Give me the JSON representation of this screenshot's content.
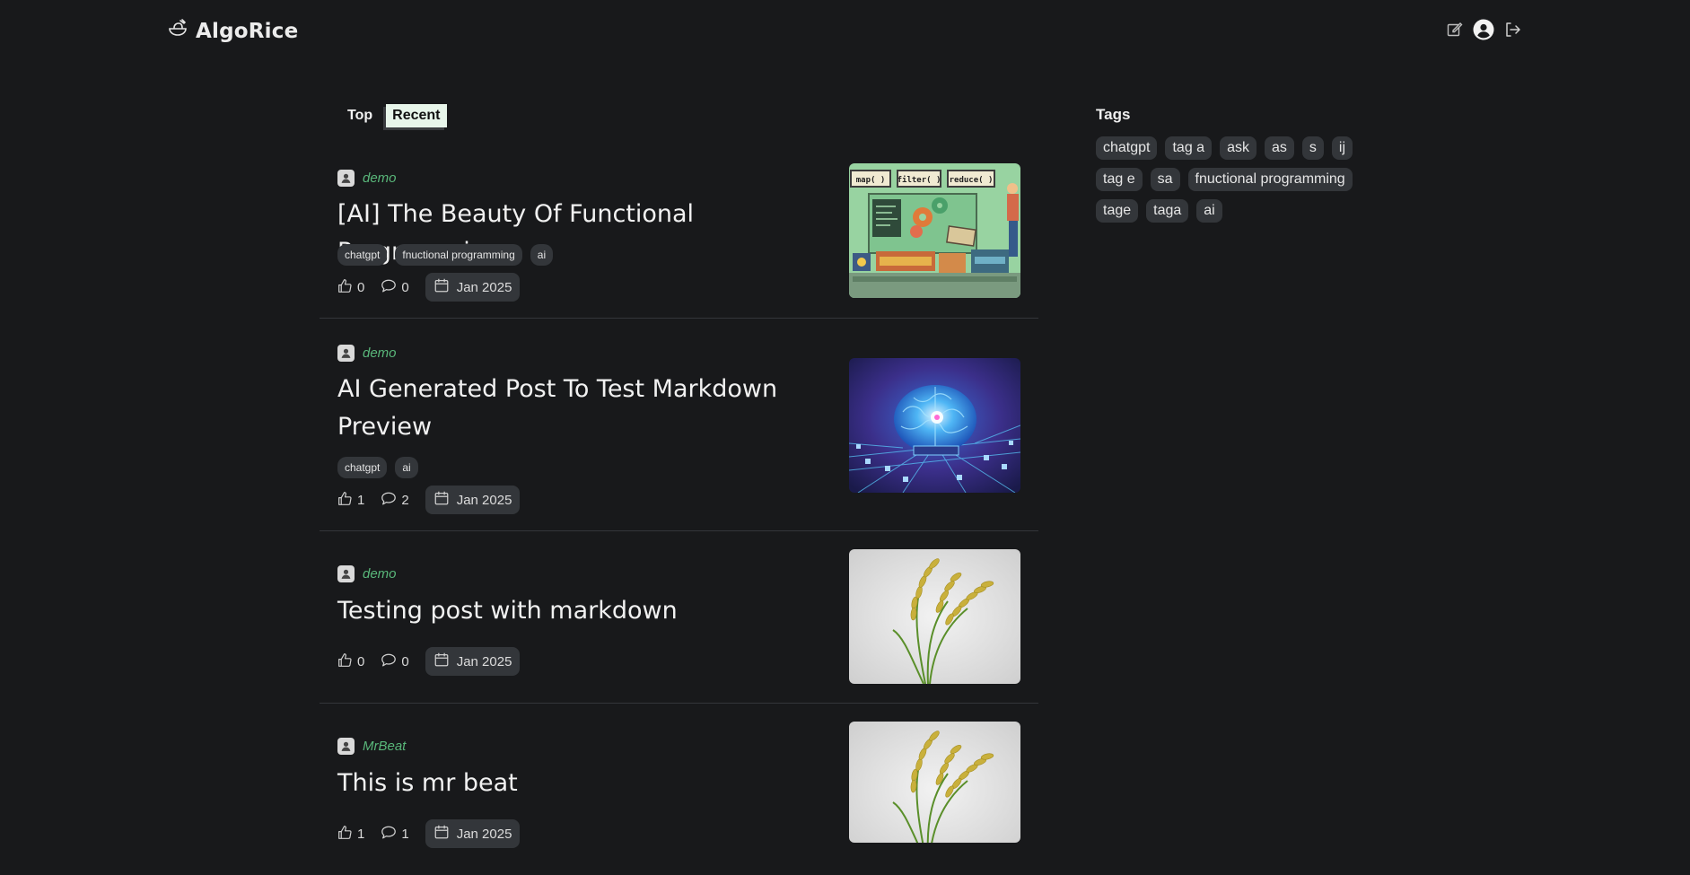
{
  "brand": {
    "name": "AlgoRice",
    "icon": "rice-bowl-icon"
  },
  "header": {
    "actions": [
      {
        "icon": "edit-icon"
      },
      {
        "icon": "user-avatar-icon"
      },
      {
        "icon": "logout-icon"
      }
    ]
  },
  "tabs": [
    {
      "label": "Top",
      "active": false
    },
    {
      "label": "Recent",
      "active": true
    }
  ],
  "posts": [
    {
      "author": "demo",
      "title": "[AI] The Beauty Of Functional Programming",
      "tags": [
        "chatgpt",
        "fnuctional programming",
        "ai"
      ],
      "likes": "0",
      "comments": "0",
      "date": "Jan 2025",
      "thumb_labels": [
        "map( )",
        "filter( )",
        "reduce( )"
      ]
    },
    {
      "author": "demo",
      "title": "AI Generated Post To Test Markdown Preview",
      "tags": [
        "chatgpt",
        "ai"
      ],
      "likes": "1",
      "comments": "2",
      "date": "Jan 2025"
    },
    {
      "author": "demo",
      "title": "Testing post with markdown",
      "tags": [],
      "likes": "0",
      "comments": "0",
      "date": "Jan 2025"
    },
    {
      "author": "MrBeat",
      "title": "This is mr beat",
      "tags": [],
      "likes": "1",
      "comments": "1",
      "date": "Jan 2025"
    }
  ],
  "sidebar": {
    "title": "Tags",
    "tags": [
      "chatgpt",
      "tag a",
      "ask",
      "as",
      "s",
      "ij",
      "tag e",
      "sa",
      "fnuctional programming",
      "tage",
      "taga",
      "ai"
    ]
  },
  "colors": {
    "background": "#18191b",
    "accent_green": "#59b77a",
    "chip": "#33363a",
    "active_tab": "#e7f5ea"
  }
}
